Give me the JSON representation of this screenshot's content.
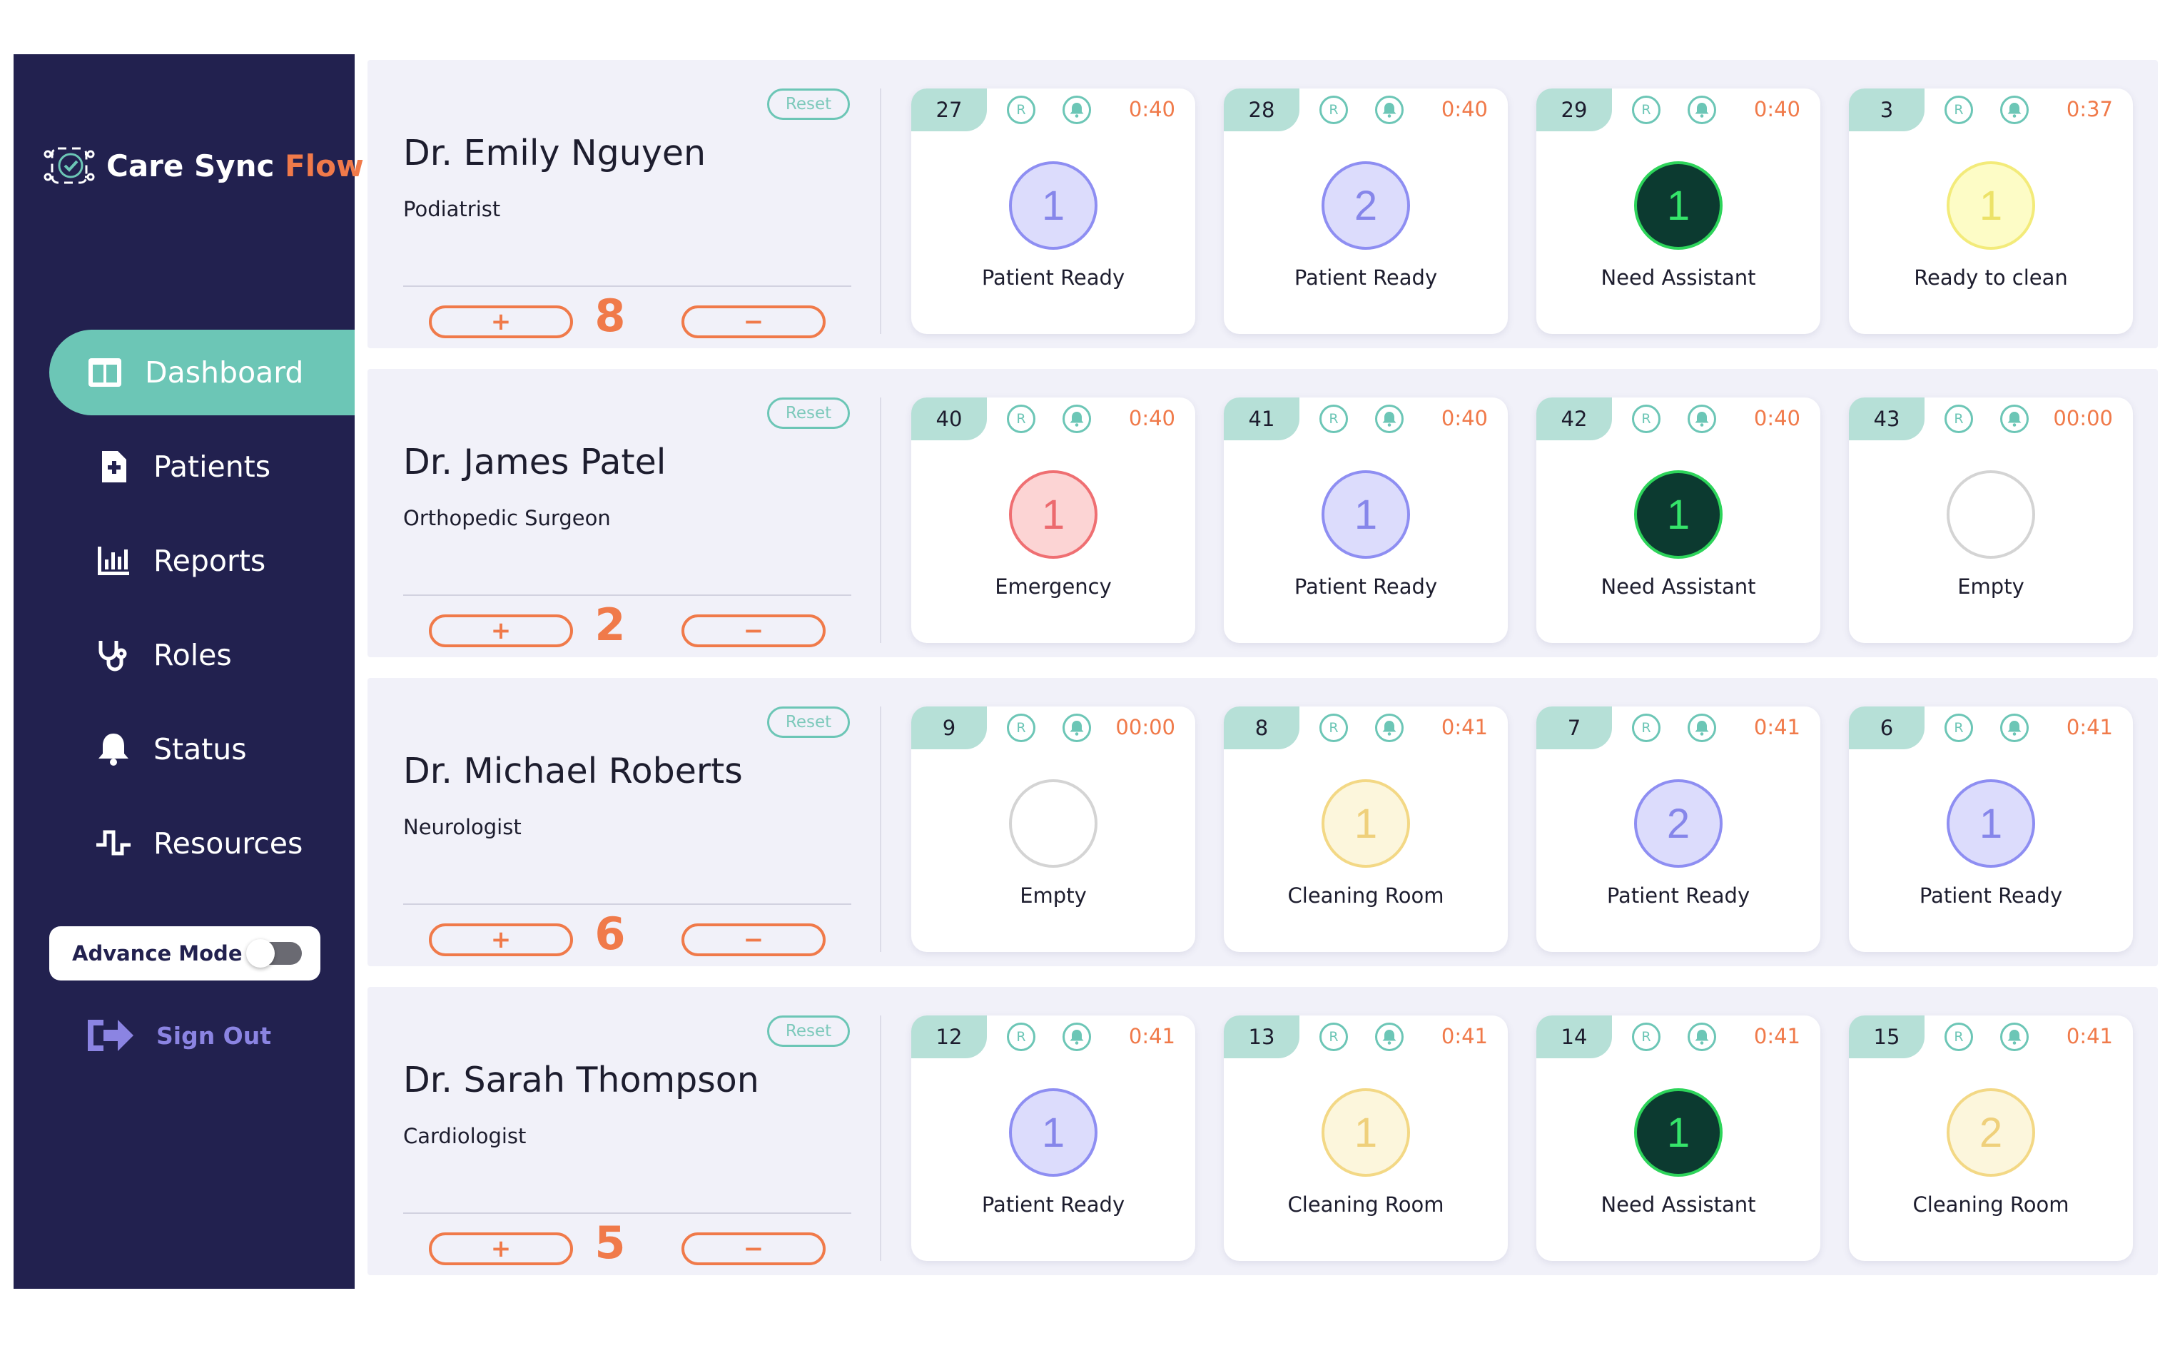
{
  "app": {
    "name_main": "Care Sync",
    "name_accent": "Flow"
  },
  "colors": {
    "sidebar": "#22214f",
    "accent_teal": "#6cc6b6",
    "accent_orange": "#f07a4a",
    "patient_ready": "#8e8ef2",
    "need_assistant": "#0c3a30",
    "ready_to_clean": "#fdfcc6",
    "cleaning_room": "#fcf6dc",
    "emergency": "#ef6f72",
    "empty": "#ffffff"
  },
  "sidebar": {
    "items": [
      {
        "label": "Dashboard",
        "icon": "dashboard-icon",
        "active": true
      },
      {
        "label": "Patients",
        "icon": "patient-file-icon",
        "active": false
      },
      {
        "label": "Reports",
        "icon": "bar-chart-icon",
        "active": false
      },
      {
        "label": "Roles",
        "icon": "stethoscope-icon",
        "active": false
      },
      {
        "label": "Status",
        "icon": "bell-icon",
        "active": false
      },
      {
        "label": "Resources",
        "icon": "pulse-icon",
        "active": false
      }
    ],
    "advance_mode_label": "Advance Mode",
    "advance_mode_on": false,
    "sign_out_label": "Sign Out"
  },
  "labels": {
    "reset": "Reset",
    "plus": "+",
    "minus": "−",
    "r_badge": "R"
  },
  "doctors": [
    {
      "name": "Dr. Emily Nguyen",
      "specialty": "Podiatrist",
      "count": "8",
      "rooms": [
        {
          "number": "27",
          "timer": "0:40",
          "value": "1",
          "status": "Patient Ready",
          "state": "patient"
        },
        {
          "number": "28",
          "timer": "0:40",
          "value": "2",
          "status": "Patient Ready",
          "state": "patient"
        },
        {
          "number": "29",
          "timer": "0:40",
          "value": "1",
          "status": "Need Assistant",
          "state": "assistant"
        },
        {
          "number": "3",
          "timer": "0:37",
          "value": "1",
          "status": "Ready to clean",
          "state": "clean"
        }
      ]
    },
    {
      "name": "Dr. James Patel",
      "specialty": "Orthopedic Surgeon",
      "count": "2",
      "rooms": [
        {
          "number": "40",
          "timer": "0:40",
          "value": "1",
          "status": "Emergency",
          "state": "emergency"
        },
        {
          "number": "41",
          "timer": "0:40",
          "value": "1",
          "status": "Patient Ready",
          "state": "patient"
        },
        {
          "number": "42",
          "timer": "0:40",
          "value": "1",
          "status": "Need Assistant",
          "state": "assistant"
        },
        {
          "number": "43",
          "timer": "00:00",
          "value": "",
          "status": "Empty",
          "state": "empty"
        }
      ]
    },
    {
      "name": "Dr. Michael Roberts",
      "specialty": "Neurologist",
      "count": "6",
      "rooms": [
        {
          "number": "9",
          "timer": "00:00",
          "value": "",
          "status": "Empty",
          "state": "empty"
        },
        {
          "number": "8",
          "timer": "0:41",
          "value": "1",
          "status": "Cleaning Room",
          "state": "cleaning"
        },
        {
          "number": "7",
          "timer": "0:41",
          "value": "2",
          "status": "Patient Ready",
          "state": "patient"
        },
        {
          "number": "6",
          "timer": "0:41",
          "value": "1",
          "status": "Patient Ready",
          "state": "patient"
        }
      ]
    },
    {
      "name": "Dr. Sarah Thompson",
      "specialty": "Cardiologist",
      "count": "5",
      "rooms": [
        {
          "number": "12",
          "timer": "0:41",
          "value": "1",
          "status": "Patient Ready",
          "state": "patient"
        },
        {
          "number": "13",
          "timer": "0:41",
          "value": "1",
          "status": "Cleaning Room",
          "state": "cleaning"
        },
        {
          "number": "14",
          "timer": "0:41",
          "value": "1",
          "status": "Need Assistant",
          "state": "assistant"
        },
        {
          "number": "15",
          "timer": "0:41",
          "value": "2",
          "status": "Cleaning Room",
          "state": "cleaning"
        }
      ]
    }
  ]
}
